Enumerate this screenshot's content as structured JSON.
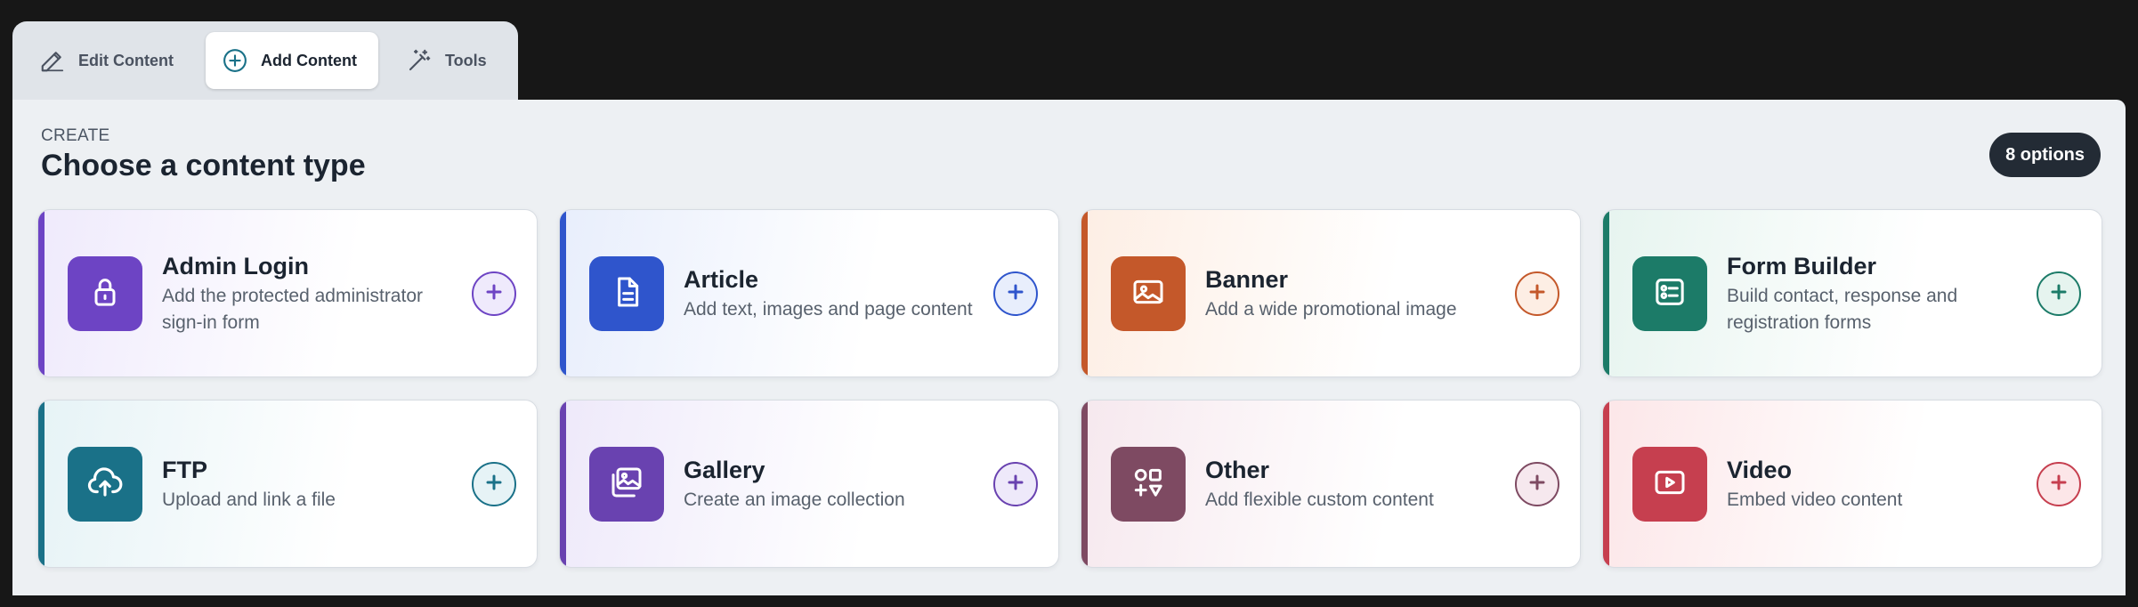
{
  "tabs": [
    {
      "label": "Edit Content",
      "icon": "pencil-icon",
      "active": false
    },
    {
      "label": "Add Content",
      "icon": "plus-circle-icon",
      "active": true
    },
    {
      "label": "Tools",
      "icon": "magic-wand-icon",
      "active": false
    }
  ],
  "header": {
    "eyebrow": "CREATE",
    "title": "Choose a content type",
    "badge": "8 options"
  },
  "cards": [
    {
      "title": "Admin Login",
      "description": "Add the protected administrator sign-in form",
      "icon": "lock-icon",
      "color": "#6d44c4",
      "tint": "#efeafc"
    },
    {
      "title": "Article",
      "description": "Add text, images and page content",
      "icon": "document-icon",
      "color": "#2f55cc",
      "tint": "#e8eefc"
    },
    {
      "title": "Banner",
      "description": "Add a wide promotional image",
      "icon": "image-icon",
      "color": "#c4582a",
      "tint": "#fdeee4"
    },
    {
      "title": "Form Builder",
      "description": "Build contact, response and registration forms",
      "icon": "form-icon",
      "color": "#1c7b68",
      "tint": "#e6f4ef"
    },
    {
      "title": "FTP",
      "description": "Upload and link a file",
      "icon": "cloud-upload-icon",
      "color": "#1a7188",
      "tint": "#e6f3f6"
    },
    {
      "title": "Gallery",
      "description": "Create an image collection",
      "icon": "gallery-icon",
      "color": "#6942b0",
      "tint": "#eee9fa"
    },
    {
      "title": "Other",
      "description": "Add flexible custom content",
      "icon": "shapes-icon",
      "color": "#7e4a62",
      "tint": "#f6e8ee"
    },
    {
      "title": "Video",
      "description": "Embed video content",
      "icon": "video-icon",
      "color": "#c63f4f",
      "tint": "#fce6e8"
    }
  ]
}
